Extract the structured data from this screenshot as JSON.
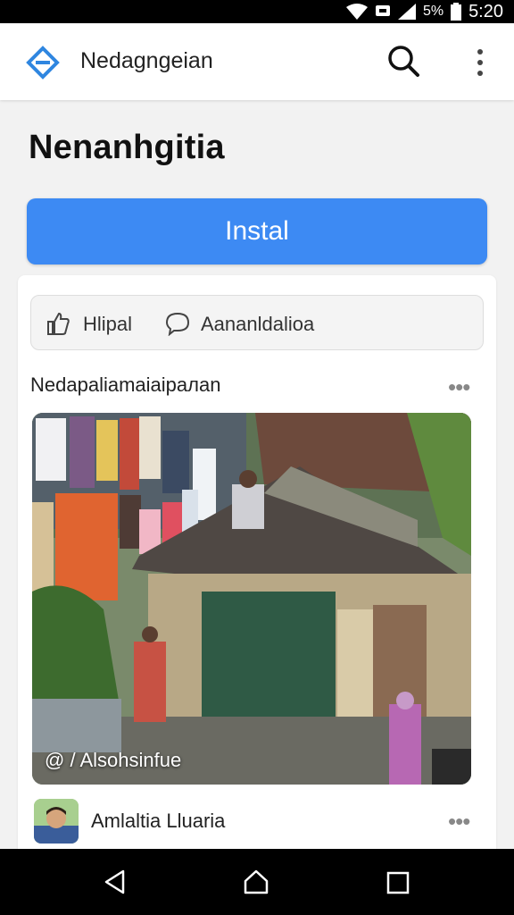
{
  "status_bar": {
    "battery_text": "5%",
    "time": "5:20"
  },
  "app_bar": {
    "title": "Nedagngeian",
    "logo_icon": "diamond-logo-icon",
    "search_icon": "search-icon",
    "menu_icon": "more-vert-icon"
  },
  "page": {
    "title": "Nenanhgitia",
    "install_label": "Instal",
    "accent_color": "#3d8af3"
  },
  "actions": {
    "like_label": "Hlipal",
    "comment_label": "Aananldalioa"
  },
  "post": {
    "author": "Nedapaliamaiaipaлan",
    "photo_caption": "@ / Alsohsinfue",
    "more_icon": "more-horiz-icon"
  },
  "comment": {
    "user_name": "Amlaltia Lluaria"
  },
  "nav_bar": {
    "back_icon": "back-triangle-icon",
    "home_icon": "home-icon",
    "recent_icon": "recents-square-icon"
  }
}
